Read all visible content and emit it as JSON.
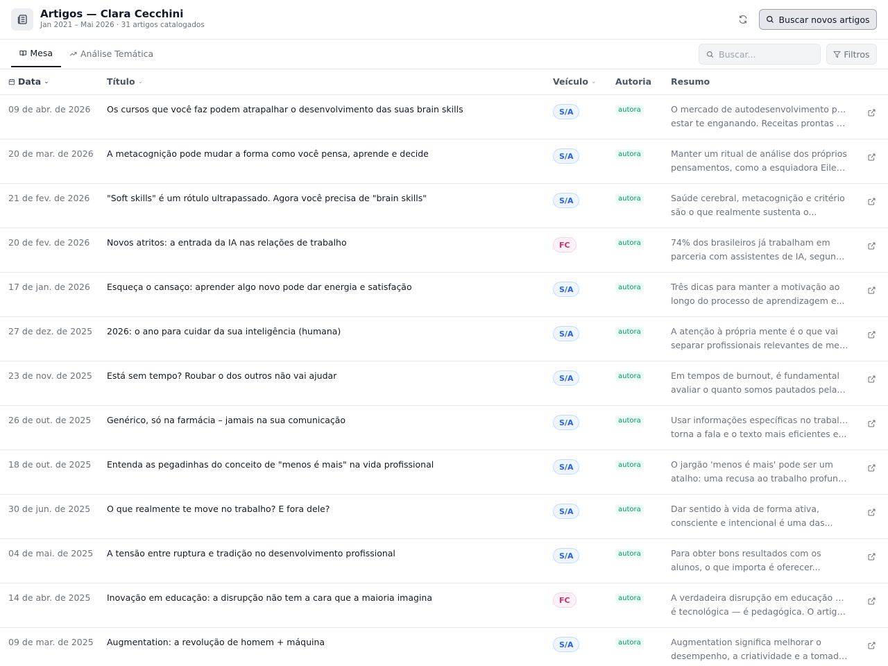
{
  "header": {
    "title": "Artigos — Clara Cecchini",
    "subtitle": "Jan 2021 – Mai 2026 · 31 artigos catalogados",
    "fetch_button": "Buscar novos artigos"
  },
  "tabs": [
    {
      "label": "Mesa",
      "icon": "book-open-icon",
      "active": true
    },
    {
      "label": "Análise Temática",
      "icon": "trending-up-icon",
      "active": false
    }
  ],
  "search": {
    "placeholder": "Buscar..."
  },
  "filters": {
    "label": "Filtros"
  },
  "table": {
    "columns": {
      "date": "Data",
      "title": "Título",
      "vehicle": "Veículo",
      "authorship": "Autoria",
      "summary": "Resumo"
    },
    "rows": [
      {
        "date": "09 de abr. de 2026",
        "title": "Os cursos que você faz podem atrapalhar o desenvolvimento das suas brain skills",
        "vehicle": "S/A",
        "authorship": "autora",
        "summary": [
          "O mercado de autodesenvolvimento pode",
          "estar te enganando. Receitas prontas e..."
        ]
      },
      {
        "date": "20 de mar. de 2026",
        "title": "A metacognição pode mudar a forma como você pensa, aprende e decide",
        "vehicle": "S/A",
        "authorship": "autora",
        "summary": [
          "Manter um ritual de análise dos próprios",
          "pensamentos, como a esquiadora Eilee..."
        ]
      },
      {
        "date": "21 de fev. de 2026",
        "title": "\"Soft skills\" é um rótulo ultrapassado. Agora você precisa de \"brain skills\"",
        "vehicle": "S/A",
        "authorship": "autora",
        "summary": [
          "Saúde cerebral, metacognição e critério",
          "são o que realmente sustenta o..."
        ]
      },
      {
        "date": "20 de fev. de 2026",
        "title": "Novos atritos: a entrada da IA nas relações de trabalho",
        "vehicle": "FC",
        "authorship": "autora",
        "summary": [
          "74% dos brasileiros já trabalham em",
          "parceria com assistentes de IA, segund..."
        ]
      },
      {
        "date": "17 de jan. de 2026",
        "title": "Esqueça o cansaço: aprender algo novo pode dar energia e satisfação",
        "vehicle": "S/A",
        "authorship": "autora",
        "summary": [
          "Três dicas para manter a motivação ao",
          "longo do processo de aprendizagem e..."
        ]
      },
      {
        "date": "27 de dez. de 2025",
        "title": "2026: o ano para cuidar da sua inteligência (humana)",
        "vehicle": "S/A",
        "authorship": "autora",
        "summary": [
          "A atenção à própria mente é o que vai",
          "separar profissionais relevantes de mer..."
        ]
      },
      {
        "date": "23 de nov. de 2025",
        "title": "Está sem tempo? Roubar o dos outros não vai ajudar",
        "vehicle": "S/A",
        "authorship": "autora",
        "summary": [
          "Em tempos de burnout, é fundamental",
          "avaliar o quanto somos pautados pelas..."
        ]
      },
      {
        "date": "26 de out. de 2025",
        "title": "Genérico, só na farmácia – jamais na sua comunicação",
        "vehicle": "S/A",
        "authorship": "autora",
        "summary": [
          "Usar informações específicas no trabalho",
          "torna a fala e o texto mais eficientes e..."
        ]
      },
      {
        "date": "18 de out. de 2025",
        "title": "Entenda as pegadinhas do conceito de \"menos é mais\" na vida profissional",
        "vehicle": "S/A",
        "authorship": "autora",
        "summary": [
          "O jargão 'menos é mais' pode ser um",
          "atalho: uma recusa ao trabalho profund..."
        ]
      },
      {
        "date": "30 de jun. de 2025",
        "title": "O que realmente te move no trabalho? E fora dele?",
        "vehicle": "S/A",
        "authorship": "autora",
        "summary": [
          "Dar sentido à vida de forma ativa,",
          "consciente e intencional é uma das..."
        ]
      },
      {
        "date": "04 de mai. de 2025",
        "title": "A tensão entre ruptura e tradição no desenvolvimento profissional",
        "vehicle": "S/A",
        "authorship": "autora",
        "summary": [
          "Para obter bons resultados com os",
          "alunos, o que importa é oferecer..."
        ]
      },
      {
        "date": "14 de abr. de 2025",
        "title": "Inovação em educação: a disrupção não tem a cara que a maioria imagina",
        "vehicle": "FC",
        "authorship": "autora",
        "summary": [
          "A verdadeira disrupção em educação não",
          "é tecnológica — é pedagógica. O artigo..."
        ]
      },
      {
        "date": "09 de mar. de 2025",
        "title": "Augmentation: a revolução de homem + máquina",
        "vehicle": "S/A",
        "authorship": "autora",
        "summary": [
          "Augmentation significa melhorar o",
          "desempenho, a criatividade e a tomada..."
        ]
      }
    ]
  },
  "colors": {
    "sa_badge": "#2563eb",
    "fc_badge": "#db2777",
    "authorship_badge": "#059669"
  }
}
